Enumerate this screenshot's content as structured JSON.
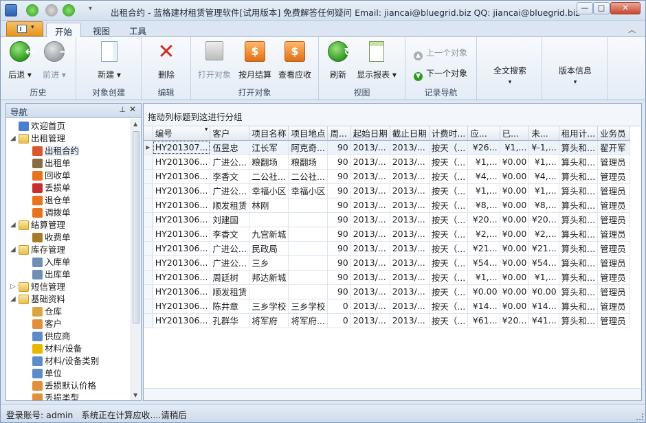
{
  "window": {
    "title": "出租合约 - 蓝格建材租赁管理软件[试用版本] 免费解答任何疑问 Email: jiancai@bluegrid.biz QQ: jiancai@bluegrid.biz"
  },
  "tabs": [
    "开始",
    "视图",
    "工具"
  ],
  "ribbon": {
    "back": "后退",
    "forward": "前进",
    "history": "历史",
    "new": "新建",
    "object_create": "对象创建",
    "delete": "删除",
    "edit": "编辑",
    "open_object": "打开对象",
    "monthly_settle": "按月结算",
    "view_receivable": "查看应收",
    "open_group": "打开对象",
    "refresh": "刷新",
    "show_report": "显示报表",
    "view_group": "视图",
    "prev_object": "上一个对象",
    "next_object": "下一个对象",
    "record_nav": "记录导航",
    "fulltext_search": "全文搜索",
    "version_info": "版本信息"
  },
  "nav": {
    "title": "导航",
    "items": [
      {
        "label": "欢迎首页",
        "level": 0,
        "icon": "home-icon"
      },
      {
        "label": "出租管理",
        "level": 0,
        "icon": "folder-icon",
        "expand": "◢"
      },
      {
        "label": "出租合约",
        "level": 1,
        "icon": "contract-icon",
        "selected": true
      },
      {
        "label": "出租单",
        "level": 1,
        "icon": "rent-order-icon"
      },
      {
        "label": "回收单",
        "level": 1,
        "icon": "recycle-icon"
      },
      {
        "label": "丢损单",
        "level": 1,
        "icon": "loss-icon"
      },
      {
        "label": "退仓单",
        "level": 1,
        "icon": "return-icon"
      },
      {
        "label": "调拨单",
        "level": 1,
        "icon": "transfer-icon"
      },
      {
        "label": "结算管理",
        "level": 0,
        "icon": "folder-icon",
        "expand": "◢"
      },
      {
        "label": "收费单",
        "level": 1,
        "icon": "moneybag-icon"
      },
      {
        "label": "库存管理",
        "level": 0,
        "icon": "folder-icon",
        "expand": "◢"
      },
      {
        "label": "入库单",
        "level": 1,
        "icon": "stock-in-icon"
      },
      {
        "label": "出库单",
        "level": 1,
        "icon": "stock-out-icon"
      },
      {
        "label": "短信管理",
        "level": 0,
        "icon": "folder-icon",
        "expand": "▷"
      },
      {
        "label": "基础资料",
        "level": 0,
        "icon": "folder-icon",
        "expand": "◢"
      },
      {
        "label": "仓库",
        "level": 1,
        "icon": "warehouse-icon"
      },
      {
        "label": "客户",
        "level": 1,
        "icon": "customer-icon"
      },
      {
        "label": "供应商",
        "level": 1,
        "icon": "supplier-icon"
      },
      {
        "label": "材料/设备",
        "level": 1,
        "icon": "material-icon"
      },
      {
        "label": "材料/设备类别",
        "level": 1,
        "icon": "category-icon"
      },
      {
        "label": "单位",
        "level": 1,
        "icon": "unit-icon"
      },
      {
        "label": "丢损默认价格",
        "level": 1,
        "icon": "price-icon"
      },
      {
        "label": "丢损类型",
        "level": 1,
        "icon": "loss-type-icon"
      }
    ]
  },
  "grid": {
    "group_hint": "拖动列标题到这进行分组",
    "columns": [
      "编号",
      "客户",
      "项目名称",
      "项目地点",
      "周...",
      "起始日期",
      "截止日期",
      "计费时...",
      "应...",
      "已...",
      "未...",
      "租用计...",
      "业务员"
    ],
    "rows": [
      [
        "HY201307...",
        "伍昱忠",
        "江长军",
        "阿克奇...",
        "90",
        "2013/...",
        "2013/...",
        "按天（...",
        "¥26...",
        "¥1,...",
        "¥-1,...",
        "算头和...",
        "翟开军"
      ],
      [
        "HY201306...",
        "广进公...",
        "粮翻场",
        "粮翻场",
        "90",
        "2013/...",
        "2013/...",
        "按天（...",
        "¥1,...",
        "¥0.00",
        "¥1,...",
        "算头和...",
        "管理员"
      ],
      [
        "HY201306...",
        "李香文",
        "二公社...",
        "二公社...",
        "90",
        "2013/...",
        "2013/...",
        "按天（...",
        "¥4,...",
        "¥0.00",
        "¥4,...",
        "算头和...",
        "管理员"
      ],
      [
        "HY201306...",
        "广进公...",
        "幸福小区",
        "幸福小区",
        "90",
        "2013/...",
        "2013/...",
        "按天（...",
        "¥1,...",
        "¥0.00",
        "¥1,...",
        "算头和...",
        "管理员"
      ],
      [
        "HY201306...",
        "顺发租赁",
        "林刚",
        "",
        "90",
        "2013/...",
        "2013/...",
        "按天（...",
        "¥8,...",
        "¥0.00",
        "¥8,...",
        "算头和...",
        "管理员"
      ],
      [
        "HY201306...",
        "刘建国",
        "",
        "",
        "90",
        "2013/...",
        "2013/...",
        "按天（...",
        "¥20...",
        "¥0.00",
        "¥20...",
        "算头和...",
        "管理员"
      ],
      [
        "HY201306...",
        "李香文",
        "九宫新城",
        "",
        "90",
        "2013/...",
        "2013/...",
        "按天（...",
        "¥2,...",
        "¥0.00",
        "¥2,...",
        "算头和...",
        "管理员"
      ],
      [
        "HY201306...",
        "广进公...",
        "民政局",
        "",
        "90",
        "2013/...",
        "2013/...",
        "按天（...",
        "¥21...",
        "¥0.00",
        "¥21...",
        "算头和...",
        "管理员"
      ],
      [
        "HY201306...",
        "广进公...",
        "三乡",
        "",
        "90",
        "2013/...",
        "2013/...",
        "按天（...",
        "¥54...",
        "¥0.00",
        "¥54...",
        "算头和...",
        "管理员"
      ],
      [
        "HY201306...",
        "周廷树",
        "邦达新城",
        "",
        "90",
        "2013/...",
        "2013/...",
        "按天（...",
        "¥1,...",
        "¥0.00",
        "¥1,...",
        "算头和...",
        "管理员"
      ],
      [
        "HY201306...",
        "顺发租赁",
        "",
        "",
        "90",
        "2013/...",
        "2013/...",
        "按天（...",
        "¥0.00",
        "¥0.00",
        "¥0.00",
        "算头和...",
        "管理员"
      ],
      [
        "HY201306...",
        "陈井章",
        "三乡学校",
        "三乡学校",
        "0",
        "2013/...",
        "2013/...",
        "按天（...",
        "¥14...",
        "¥0.00",
        "¥14...",
        "算头和...",
        "管理员"
      ],
      [
        "HY201306...",
        "孔群华",
        "将军府",
        "将军府...",
        "0",
        "2013/...",
        "2013/...",
        "按天（...",
        "¥61...",
        "¥20...",
        "¥41...",
        "算头和...",
        "管理员"
      ]
    ]
  },
  "status": {
    "account": "登录账号: admin",
    "message": "系统正在计算应收....请稍后"
  },
  "colors": {
    "accent_orange": "#e89419",
    "green": "#2f9a22",
    "delete_red": "#d22b1f"
  }
}
